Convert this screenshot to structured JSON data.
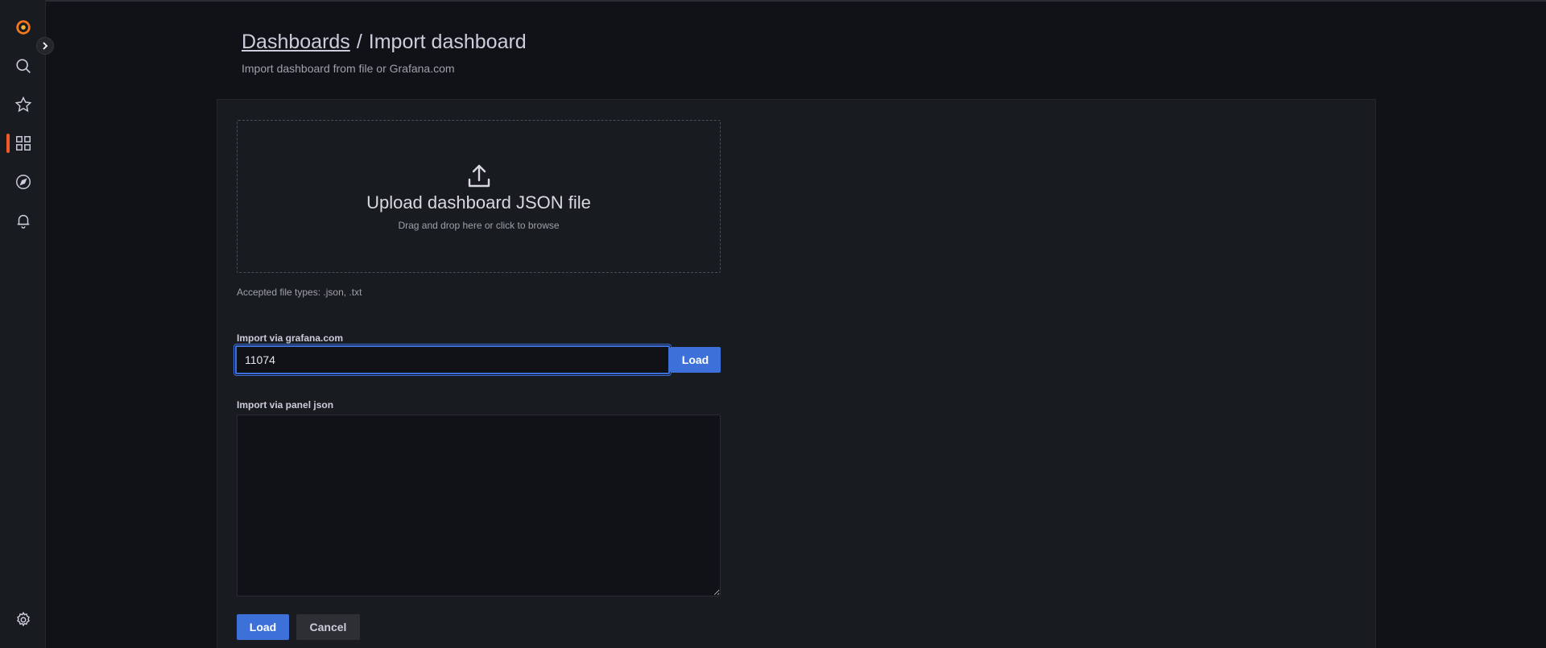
{
  "sidebar": {
    "items": [
      {
        "name": "grafana-logo-icon"
      },
      {
        "name": "search-icon"
      },
      {
        "name": "starred-icon"
      },
      {
        "name": "dashboards-icon",
        "active": true
      },
      {
        "name": "explore-icon"
      },
      {
        "name": "alerting-icon"
      },
      {
        "name": "settings-icon"
      }
    ],
    "accent_color": "#f05a28"
  },
  "header": {
    "breadcrumb_link": "Dashboards",
    "separator": "/",
    "title": "Import dashboard",
    "subtitle": "Import dashboard from file or Grafana.com"
  },
  "upload": {
    "title": "Upload dashboard JSON file",
    "subtitle": "Drag and drop here or click to browse",
    "accepted": "Accepted file types: .json, .txt"
  },
  "grafana_import": {
    "label": "Import via grafana.com",
    "value": "11074",
    "load_label": "Load"
  },
  "panel_json": {
    "label": "Import via panel json",
    "value": ""
  },
  "footer": {
    "load_label": "Load",
    "cancel_label": "Cancel"
  },
  "colors": {
    "primary": "#3d71d9",
    "background": "#111217",
    "panel": "#181b1f"
  }
}
